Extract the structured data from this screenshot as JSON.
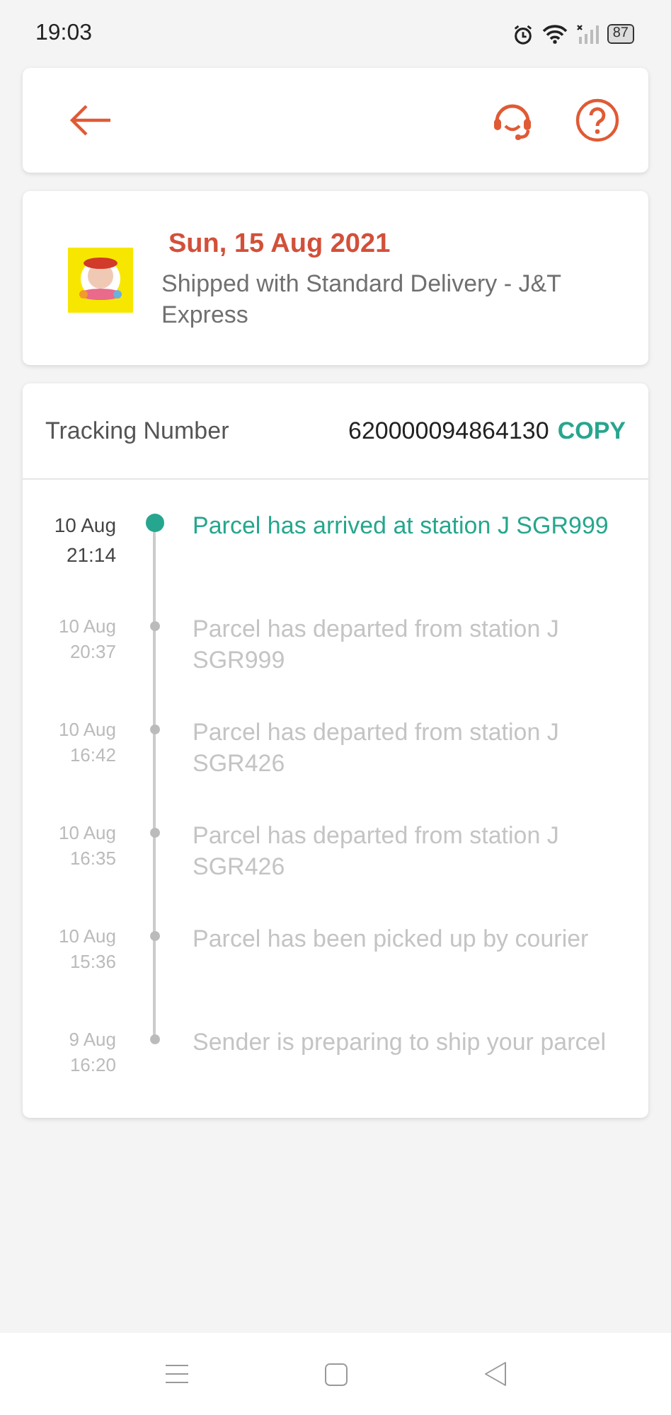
{
  "status_bar": {
    "time": "19:03",
    "battery": "87"
  },
  "delivery": {
    "date": "Sun, 15 Aug 2021",
    "shipping": "Shipped with Standard Delivery  - J&T Express"
  },
  "tracking": {
    "label": "Tracking Number",
    "number": "620000094864130",
    "copy": "COPY"
  },
  "events": [
    {
      "date": "10 Aug",
      "time": "21:14",
      "text": "Parcel has arrived at station J SGR999",
      "current": true
    },
    {
      "date": "10 Aug",
      "time": "20:37",
      "text": "Parcel has departed from station J SGR999",
      "current": false
    },
    {
      "date": "10 Aug",
      "time": "16:42",
      "text": "Parcel has departed from station J SGR426",
      "current": false
    },
    {
      "date": "10 Aug",
      "time": "16:35",
      "text": "Parcel has departed from station J SGR426",
      "current": false
    },
    {
      "date": "10 Aug",
      "time": "15:36",
      "text": "Parcel has been picked up by courier",
      "current": false
    },
    {
      "date": "9 Aug",
      "time": "16:20",
      "text": "Sender is preparing to ship your parcel",
      "current": false
    }
  ]
}
